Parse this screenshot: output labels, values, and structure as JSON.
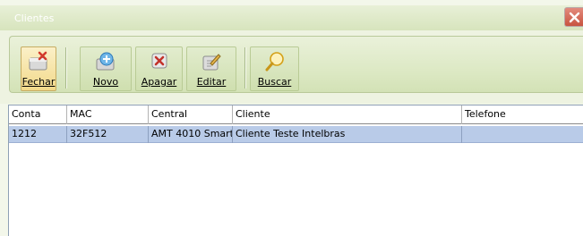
{
  "window": {
    "title": "Clientes"
  },
  "toolbar": {
    "buttons": [
      {
        "label": "Fechar",
        "icon": "close-box-icon"
      },
      {
        "label": "Novo",
        "icon": "add-globe-icon"
      },
      {
        "label": "Apagar",
        "icon": "delete-box-icon"
      },
      {
        "label": "Editar",
        "icon": "edit-pencil-icon"
      },
      {
        "label": "Buscar",
        "icon": "magnifier-icon"
      }
    ]
  },
  "table": {
    "columns": [
      "Conta",
      "MAC",
      "Central",
      "Cliente",
      "Telefone"
    ],
    "rows": [
      [
        "1212",
        "32F512",
        "AMT 4010 Smart",
        "Cliente Teste Intelbras",
        ""
      ]
    ]
  },
  "colors": {
    "accent": "#d7e4bd",
    "selection": "#b9cbe8",
    "close": "#c8543f"
  }
}
